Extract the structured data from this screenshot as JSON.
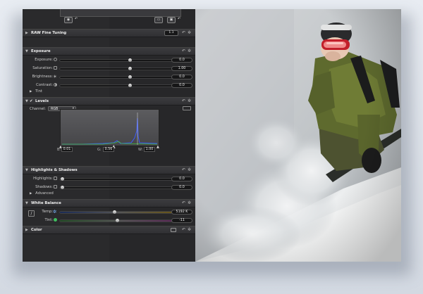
{
  "raw_fine_tuning": {
    "title": "RAW Fine Tuning",
    "preset": "1.1"
  },
  "exposure": {
    "title": "Exposure",
    "rows": [
      {
        "label": "Exposure:",
        "value": "0.0",
        "level": 0.58
      },
      {
        "label": "Saturation:",
        "value": "1.00",
        "level": 0.58
      },
      {
        "label": "Brightness:",
        "value": "0.0",
        "level": 0.58
      },
      {
        "label": "Contrast:",
        "value": "0.0",
        "level": 0.58
      }
    ],
    "tint_label": "Tint"
  },
  "levels": {
    "title": "Levels",
    "channel_label": "Channel:",
    "channel_value": "RGB",
    "black_label": "B:",
    "black_value": "0.01",
    "gray_label": "G:",
    "gray_value": "0.56",
    "white_label": "W:",
    "white_value": "1.00"
  },
  "highlights_shadows": {
    "title": "Highlights & Shadows",
    "rows": [
      {
        "label": "Highlights:",
        "value": "0.0",
        "level": 0.0
      },
      {
        "label": "Shadows:",
        "value": "0.0",
        "level": 0.0
      }
    ],
    "advanced_label": "Advanced"
  },
  "white_balance": {
    "title": "White Balance",
    "rows": [
      {
        "label": "Temp:",
        "value": "5192 K",
        "level": 0.45
      },
      {
        "label": "Tint:",
        "value": "-11",
        "level": 0.47
      }
    ]
  },
  "color": {
    "title": "Color"
  },
  "icons": {
    "collapse": "triangle-icon",
    "reset": "undo-icon",
    "gear": "gear-icon"
  },
  "colors": {
    "panel": "#2a2a2c",
    "header": "#36363a",
    "track": "#161617"
  }
}
